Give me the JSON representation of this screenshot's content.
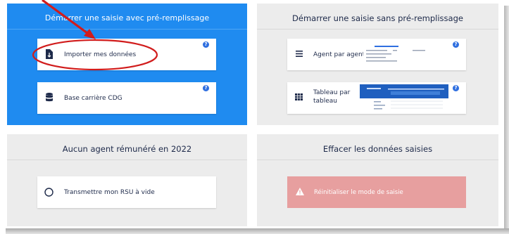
{
  "panels": {
    "prefill": {
      "title": "Démarrer une saisie avec pré-remplissage",
      "import_label": "Importer mes données",
      "import_help": "?",
      "cdg_label": "Base carrière CDG",
      "cdg_help": "?"
    },
    "no_prefill": {
      "title": "Démarrer une saisie sans pré-remplissage",
      "agent_label": "Agent par agent",
      "agent_help": "?",
      "table_label": "Tableau par tableau",
      "table_help": "?"
    },
    "no_agent": {
      "title": "Aucun agent rémunéré en 2022",
      "rsu_label": "Transmettre mon RSU à vide"
    },
    "erase": {
      "title": "Effacer les données saisies",
      "reset_label": "Réinitialiser le mode de saisie"
    }
  },
  "colors": {
    "accent_blue": "#1f8bf0",
    "panel_grey": "#ececec",
    "help_blue": "#2f6fe0",
    "reset_red": "#e79f9f",
    "annotation_red": "#d11c1c"
  },
  "icons": {
    "import": "file-import-icon",
    "cdg": "database-icon",
    "agent": "list-icon",
    "table": "table-grid-icon",
    "rsu": "radio-empty-icon",
    "reset": "warning-icon"
  }
}
